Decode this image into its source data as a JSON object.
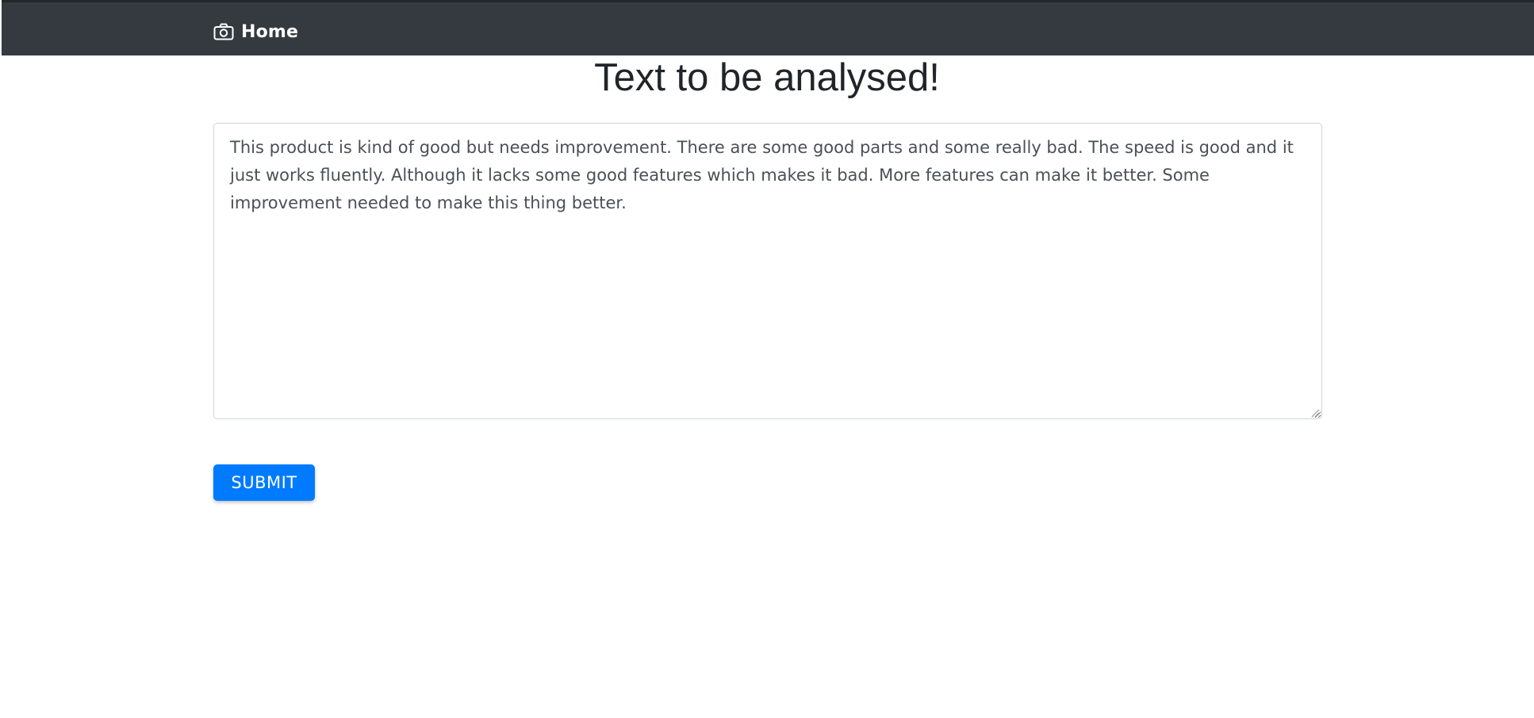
{
  "navbar": {
    "brand_label": "Home",
    "brand_icon": "camera-icon",
    "background_color": "#343a40"
  },
  "main": {
    "title": "Text to be analysed!",
    "textarea_value": "This product is kind of good but needs improvement. There are some good parts and some really bad. The speed is good and it just works fluently. Although it lacks some good features which makes it bad. More features can make it better. Some improvement needed to make this thing better.",
    "submit_label": "SUBMIT",
    "accent_color": "#007bff"
  }
}
